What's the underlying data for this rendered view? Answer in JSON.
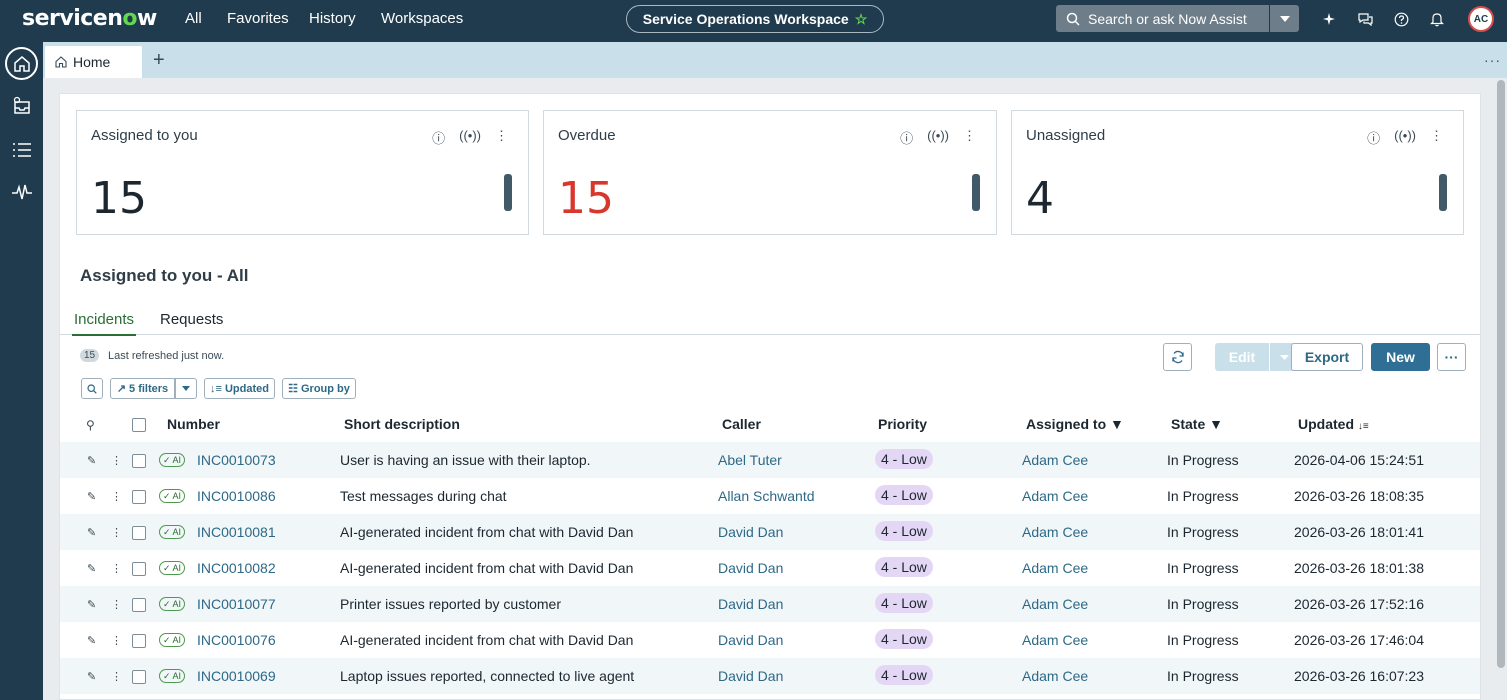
{
  "topbar": {
    "logo_prefix": "servicen",
    "logo_o": "o",
    "logo_suffix": "w",
    "nav": [
      "All",
      "Favorites",
      "History",
      "Workspaces"
    ],
    "workspace": "Service Operations Workspace",
    "search_placeholder": "Search or ask Now Assist",
    "avatar_initials": "AC"
  },
  "tabs_strip": {
    "home_label": "Home",
    "add": "+"
  },
  "kpis": [
    {
      "title": "Assigned to you",
      "value": "15",
      "color": "#1d2730"
    },
    {
      "title": "Overdue",
      "value": "15",
      "color": "#d9362e"
    },
    {
      "title": "Unassigned",
      "value": "4",
      "color": "#1d2730"
    }
  ],
  "list": {
    "title": "Assigned to you - All",
    "tabs": [
      "Incidents",
      "Requests"
    ],
    "count": "15",
    "refresh_text": "Last refreshed just now.",
    "buttons": {
      "edit": "Edit",
      "export": "Export",
      "new": "New"
    },
    "chips": {
      "filters": "5 filters",
      "updated": "Updated",
      "group_by": "Group by"
    },
    "columns": [
      "Number",
      "Short description",
      "Caller",
      "Priority",
      "Assigned to",
      "State",
      "Updated"
    ],
    "ai_label": "AI",
    "rows": [
      {
        "number": "INC0010073",
        "desc": "User is having an issue with their laptop.",
        "caller": "Abel Tuter",
        "priority": "4 - Low",
        "assigned": "Adam Cee",
        "state": "In Progress",
        "updated": "2026-04-06 15:24:51"
      },
      {
        "number": "INC0010086",
        "desc": "Test messages during chat",
        "caller": "Allan Schwantd",
        "priority": "4 - Low",
        "assigned": "Adam Cee",
        "state": "In Progress",
        "updated": "2026-03-26 18:08:35"
      },
      {
        "number": "INC0010081",
        "desc": "AI-generated incident from chat with David Dan",
        "caller": "David Dan",
        "priority": "4 - Low",
        "assigned": "Adam Cee",
        "state": "In Progress",
        "updated": "2026-03-26 18:01:41"
      },
      {
        "number": "INC0010082",
        "desc": "AI-generated incident from chat with David Dan",
        "caller": "David Dan",
        "priority": "4 - Low",
        "assigned": "Adam Cee",
        "state": "In Progress",
        "updated": "2026-03-26 18:01:38"
      },
      {
        "number": "INC0010077",
        "desc": "Printer issues reported by customer",
        "caller": "David Dan",
        "priority": "4 - Low",
        "assigned": "Adam Cee",
        "state": "In Progress",
        "updated": "2026-03-26 17:52:16"
      },
      {
        "number": "INC0010076",
        "desc": "AI-generated incident from chat with David Dan",
        "caller": "David Dan",
        "priority": "4 - Low",
        "assigned": "Adam Cee",
        "state": "In Progress",
        "updated": "2026-03-26 17:46:04"
      },
      {
        "number": "INC0010069",
        "desc": "Laptop issues reported, connected to live agent",
        "caller": "David Dan",
        "priority": "4 - Low",
        "assigned": "Adam Cee",
        "state": "In Progress",
        "updated": "2026-03-26 16:07:23"
      }
    ]
  }
}
